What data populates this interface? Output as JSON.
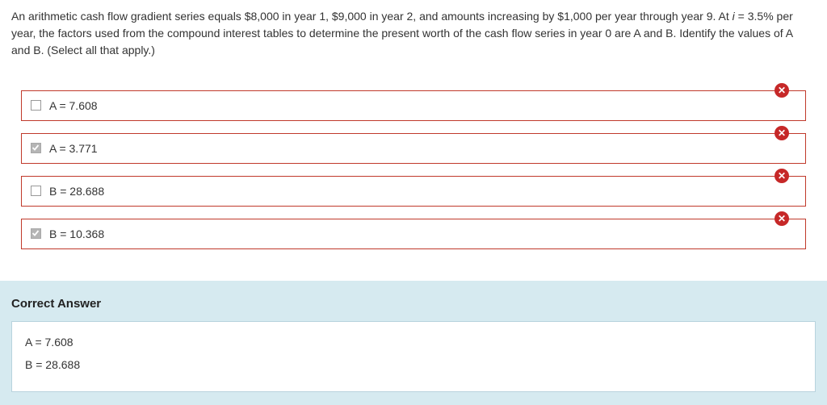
{
  "question": {
    "text_part1": "An arithmetic cash flow gradient series equals $8,000 in year 1, $9,000 in year 2, and amounts increasing by $1,000 per year through year 9. At ",
    "italic_var": "i",
    "text_part2": " = 3.5% per year, the factors used from the compound interest tables to determine the present worth of the cash flow series in year 0 are A and B. Identify the values of A and B. (Select all that apply.)"
  },
  "options": [
    {
      "label": "A = 7.608",
      "checked": false,
      "status": "incorrect"
    },
    {
      "label": "A = 3.771",
      "checked": true,
      "status": "incorrect"
    },
    {
      "label": "B = 28.688",
      "checked": false,
      "status": "incorrect"
    },
    {
      "label": "B = 10.368",
      "checked": true,
      "status": "incorrect"
    }
  ],
  "status_icon": "x-circle-icon",
  "status_glyph": "✕",
  "correct_answer": {
    "title": "Correct Answer",
    "lines": [
      "A = 7.608",
      "B = 28.688"
    ]
  },
  "colors": {
    "error": "#c62828",
    "panel_bg": "#d6eaf0",
    "checkbox_checked": "#b5b5b5"
  }
}
